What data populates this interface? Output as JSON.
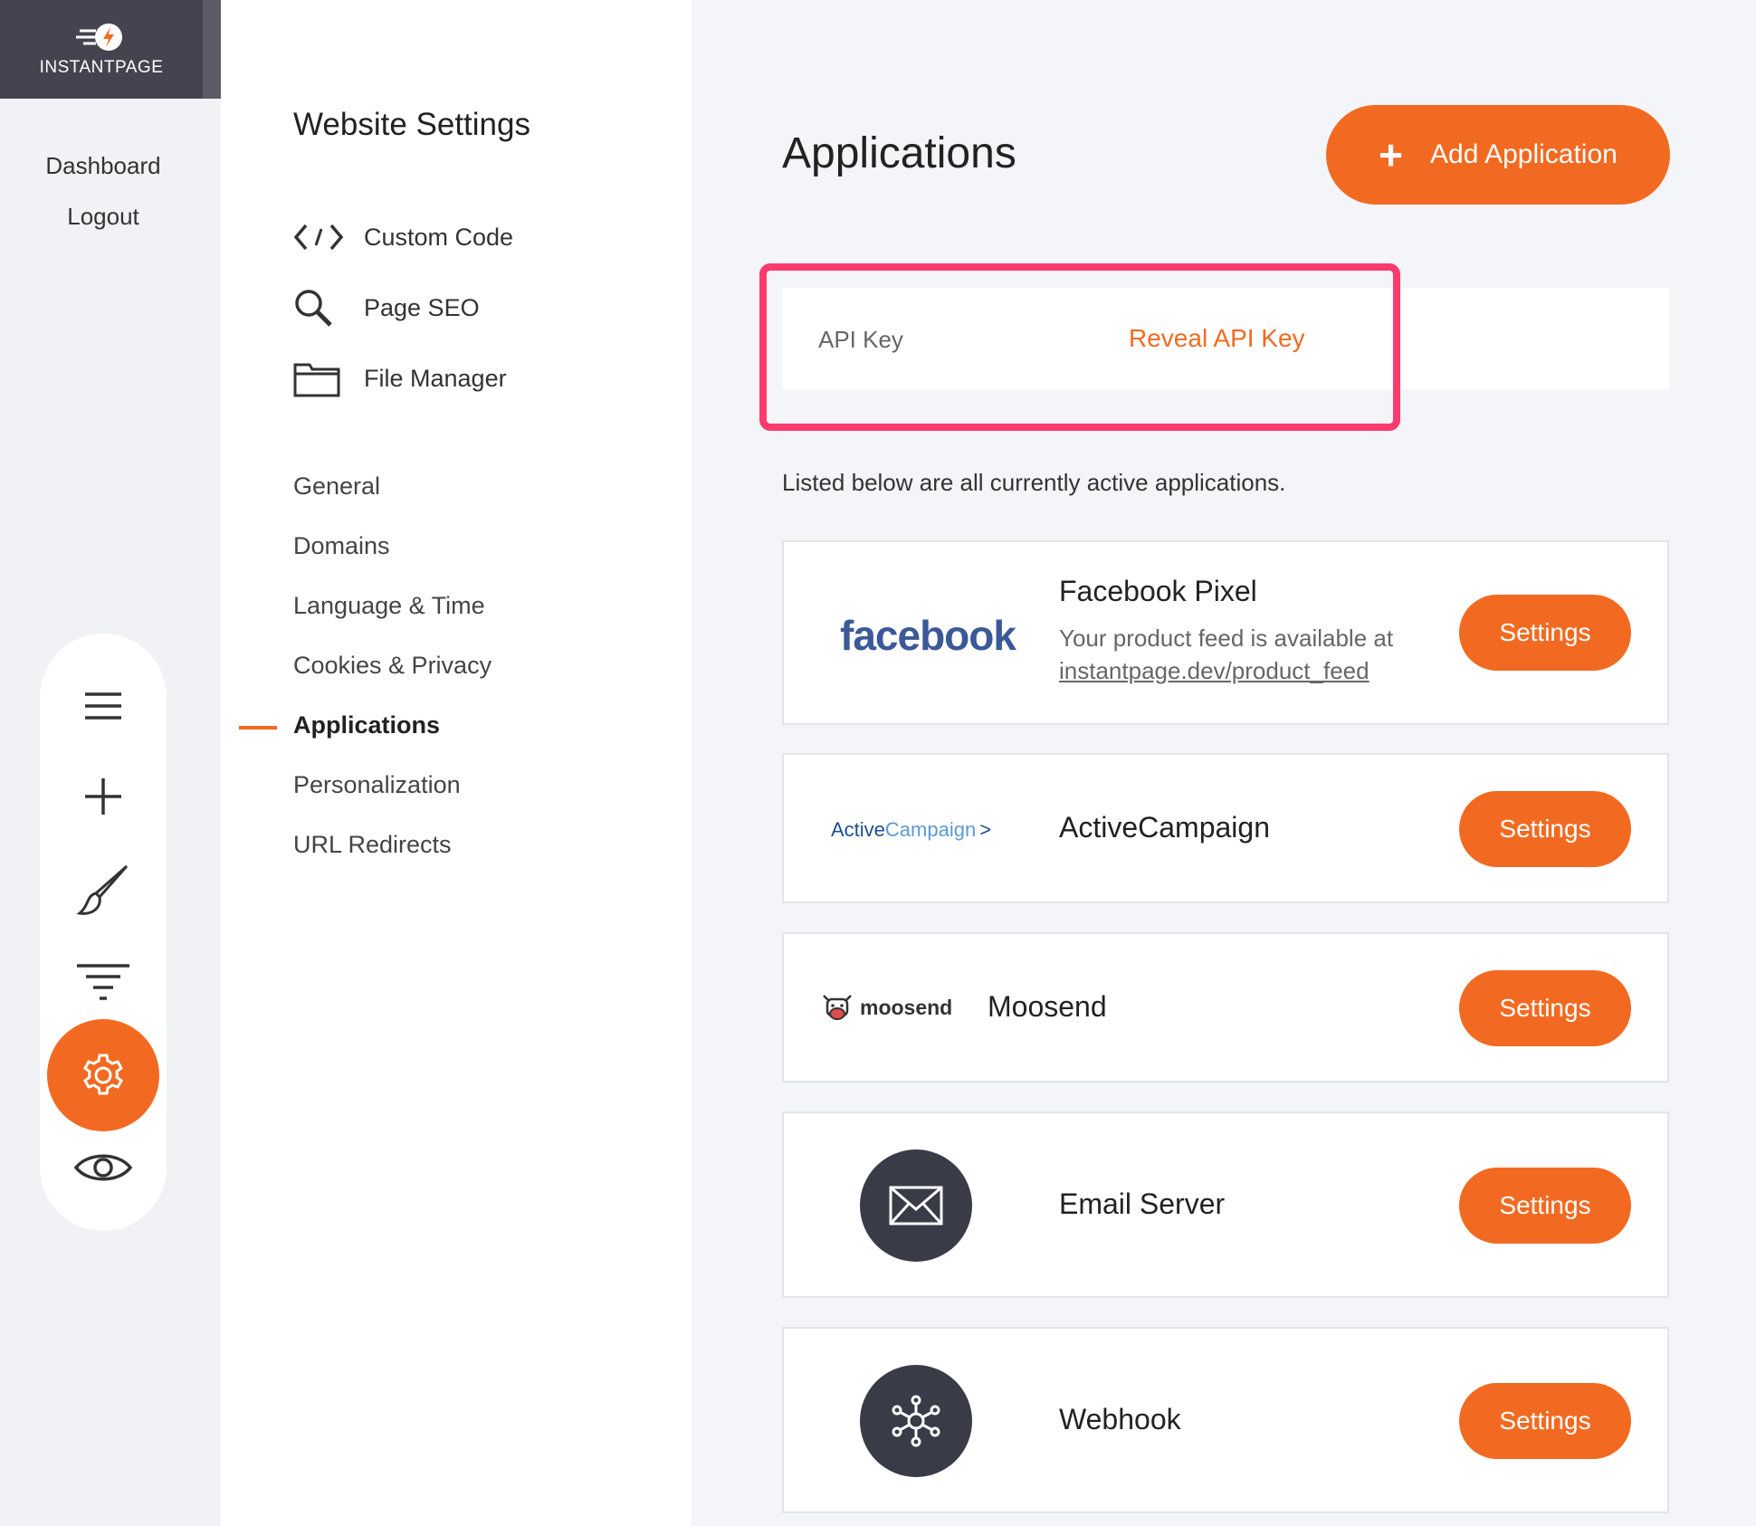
{
  "brand": {
    "name": "INSTANTPAGE",
    "accent": "#f26a21",
    "dark": "#434450",
    "highlight": "#fc3a6d"
  },
  "rail": {
    "links": [
      "Dashboard",
      "Logout"
    ],
    "tools": [
      "menu-icon",
      "plus-icon",
      "brush-icon",
      "filter-icon",
      "gear-icon",
      "eye-icon"
    ],
    "active_tool": "gear-icon"
  },
  "settings": {
    "title": "Website Settings",
    "tools": [
      {
        "label": "Custom Code",
        "icon": "code-icon"
      },
      {
        "label": "Page SEO",
        "icon": "search-icon"
      },
      {
        "label": "File Manager",
        "icon": "folder-icon"
      }
    ],
    "nav": [
      "General",
      "Domains",
      "Language & Time",
      "Cookies & Privacy",
      "Applications",
      "Personalization",
      "URL Redirects"
    ],
    "active_nav": "Applications"
  },
  "main": {
    "title": "Applications",
    "add_button": "Add Application",
    "api": {
      "label": "API Key",
      "reveal": "Reveal API Key"
    },
    "intro": "Listed below are all currently active applications.",
    "settings_label": "Settings",
    "apps": [
      {
        "name": "Facebook Pixel",
        "logo": "facebook",
        "description": "Your product feed is available at",
        "link": "instantpage.dev/product_feed"
      },
      {
        "name": "ActiveCampaign",
        "logo_parts": [
          "Active",
          "Campaign"
        ]
      },
      {
        "name": "Moosend",
        "logo": "moosend"
      },
      {
        "name": "Email Server",
        "icon": "envelope-icon"
      },
      {
        "name": "Webhook",
        "icon": "webhook-icon"
      }
    ]
  }
}
